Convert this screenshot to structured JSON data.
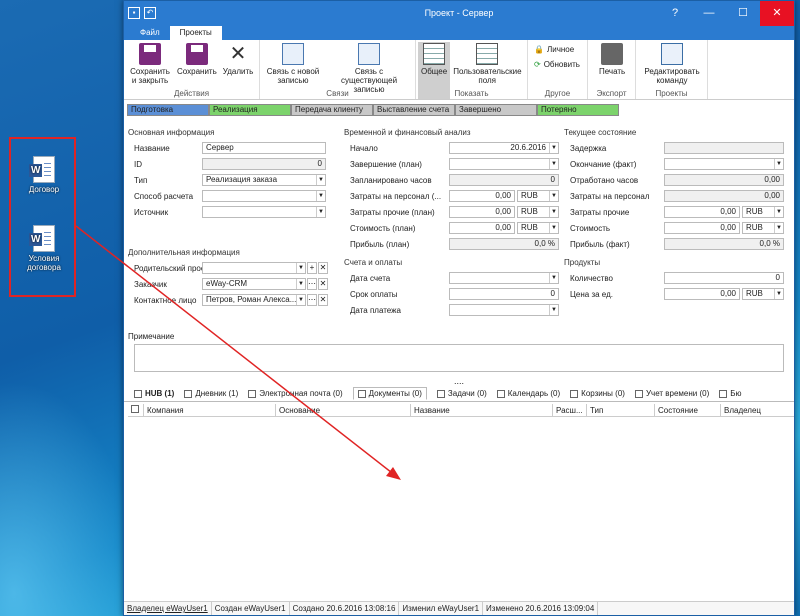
{
  "desktop": {
    "icons": [
      {
        "label": "Договор"
      },
      {
        "label": "Условия договора"
      }
    ]
  },
  "window": {
    "title": "Проект - Сервер"
  },
  "menu_tabs": [
    "Файл",
    "Проекты"
  ],
  "ribbon": {
    "actions": {
      "save_close": "Сохранить и закрыть",
      "save": "Сохранить",
      "delete": "Удалить",
      "group": "Действия"
    },
    "links": {
      "new_link": "Связь с новой записью",
      "existing_link": "Связь с существующей записью",
      "group": "Связи"
    },
    "view": {
      "general": "Общее",
      "custom": "Пользовательские поля",
      "group": "Показать"
    },
    "other": {
      "private": "Личное",
      "refresh": "Обновить",
      "group": "Другое"
    },
    "export": {
      "print": "Печать",
      "group": "Экспорт"
    },
    "projects": {
      "edit_team": "Редактировать команду",
      "group": "Проекты"
    }
  },
  "stages": [
    {
      "label": "Подготовка",
      "color": "#5b8fd6"
    },
    {
      "label": "Реализация",
      "color": "#7cd36b"
    },
    {
      "label": "Передача клиенту",
      "color": "#c8c8c8"
    },
    {
      "label": "Выставление счета",
      "color": "#c8c8c8"
    },
    {
      "label": "Завершено",
      "color": "#c8c8c8"
    },
    {
      "label": "Потеряно",
      "color": "#7cd36b"
    }
  ],
  "basic": {
    "title": "Основная информация",
    "name_label": "Название",
    "name": "Сервер",
    "id_label": "ID",
    "id": "0",
    "type_label": "Тип",
    "type": "Реализация заказа",
    "calc_label": "Способ расчета",
    "calc": "",
    "source_label": "Источник",
    "source": ""
  },
  "time": {
    "title": "Временной и финансовый анализ",
    "start_label": "Начало",
    "start": "20.6.2016",
    "end_plan_label": "Завершение (план)",
    "end_plan": "",
    "hours_plan_label": "Запланировано часов",
    "hours_plan": "0",
    "staff_cost_label": "Затраты на персонал (...",
    "staff_cost": "0,00",
    "cur1": "RUB",
    "other_cost_label": "Затраты прочие (план)",
    "other_cost": "0,00",
    "cur2": "RUB",
    "price_plan_label": "Стоимость (план)",
    "price_plan": "0,00",
    "cur3": "RUB",
    "profit_plan_label": "Прибыль (план)",
    "profit_plan": "0,0 %"
  },
  "current": {
    "title": "Текущее состояние",
    "delay_label": "Задержка",
    "delay": "",
    "end_fact_label": "Окончание (факт)",
    "end_fact": "",
    "hours_fact_label": "Отработано часов",
    "hours_fact": "0,00",
    "staff_fact_label": "Затраты на персонал",
    "staff_fact": "0,00",
    "other_fact_label": "Затраты прочие",
    "other_fact": "0,00",
    "cur4": "RUB",
    "price_fact_label": "Стоимость",
    "price_fact": "0,00",
    "cur5": "RUB",
    "profit_fact_label": "Прибыль (факт)",
    "profit_fact": "0,0 %"
  },
  "extra": {
    "title": "Дополнительная информация",
    "parent_label": "Родительский проект",
    "parent": "",
    "customer_label": "Заказчик",
    "customer": "eWay-CRM",
    "contact_label": "Контактное лицо",
    "contact": "Петров, Роман Алекса..."
  },
  "invoices": {
    "title": "Счета и оплаты",
    "inv_date_label": "Дата счета",
    "inv_date": "",
    "due_label": "Срок оплаты",
    "due": "0",
    "pay_date_label": "Дата платежа",
    "pay_date": ""
  },
  "products": {
    "title": "Продукты",
    "qty_label": "Количество",
    "qty": "0",
    "unit_label": "Цена за ед.",
    "unit": "0,00",
    "cur6": "RUB"
  },
  "note": {
    "label": "Примечание",
    "dots": "...."
  },
  "bottom_tabs": [
    "HUB (1)",
    "Дневник (1)",
    "Электронная почта (0)",
    "Документы (0)",
    "Задачи (0)",
    "Календарь (0)",
    "Корзины (0)",
    "Учет времени (0)",
    "Бю"
  ],
  "columns": [
    "Компания",
    "Основание",
    "Название",
    "Расш...",
    "Тип",
    "Состояние",
    "Владелец"
  ],
  "status": {
    "owner": "Владелец eWayUser1",
    "created": "Создан eWayUser1",
    "created_at": "Создано 20.6.2016 13:08:16",
    "modified": "Изменил eWayUser1",
    "modified_at": "Изменено 20.6.2016 13:09:04"
  }
}
